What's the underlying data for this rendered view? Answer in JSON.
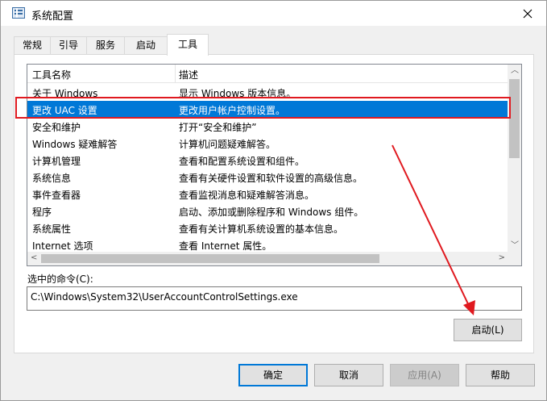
{
  "window": {
    "title": "系统配置"
  },
  "tabs": [
    {
      "label": "常规"
    },
    {
      "label": "引导"
    },
    {
      "label": "服务"
    },
    {
      "label": "启动"
    },
    {
      "label": "工具"
    }
  ],
  "tools_list": {
    "columns": [
      "工具名称",
      "描述"
    ],
    "rows": [
      {
        "name": "关于 Windows",
        "desc": "显示 Windows 版本信息。"
      },
      {
        "name": "更改 UAC 设置",
        "desc": "更改用户帐户控制设置。"
      },
      {
        "name": "安全和维护",
        "desc": "打开“安全和维护”"
      },
      {
        "name": "Windows 疑难解答",
        "desc": "计算机问题疑难解答。"
      },
      {
        "name": "计算机管理",
        "desc": "查看和配置系统设置和组件。"
      },
      {
        "name": "系统信息",
        "desc": "查看有关硬件设置和软件设置的高级信息。"
      },
      {
        "name": "事件查看器",
        "desc": "查看监视消息和疑难解答消息。"
      },
      {
        "name": "程序",
        "desc": "启动、添加或删除程序和 Windows 组件。"
      },
      {
        "name": "系统属性",
        "desc": "查看有关计算机系统设置的基本信息。"
      },
      {
        "name": "Internet 选项",
        "desc": "查看 Internet 属性。"
      }
    ],
    "selected_index": 1
  },
  "command": {
    "label": "选中的命令(C):",
    "value": "C:\\Windows\\System32\\UserAccountControlSettings.exe"
  },
  "buttons": {
    "launch": "启动(L)",
    "ok": "确定",
    "cancel": "取消",
    "apply": "应用(A)",
    "help": "帮助"
  },
  "colors": {
    "selection": "#0078d7",
    "annotation_red": "#e0191f"
  }
}
